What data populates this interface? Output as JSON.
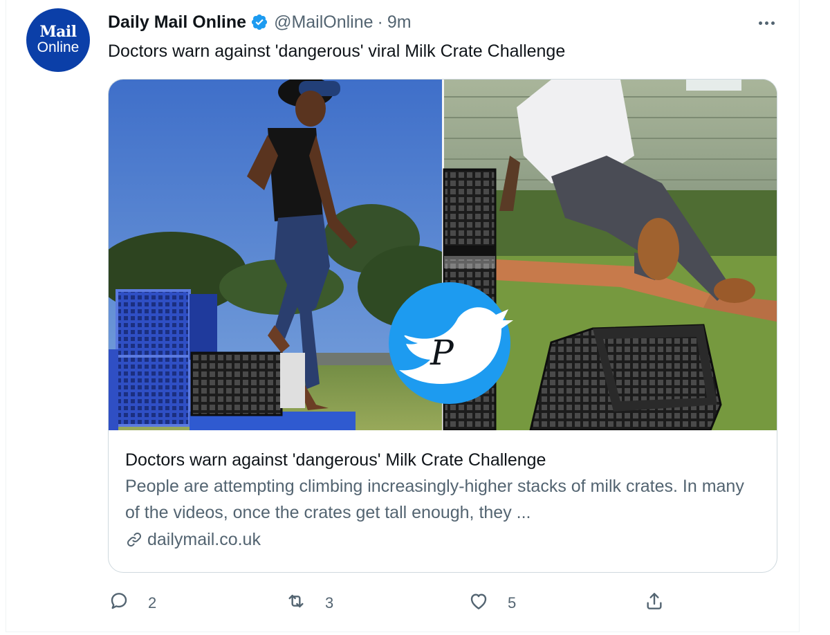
{
  "tweet": {
    "avatar": {
      "line1": "Mail",
      "line2": "Online"
    },
    "display_name": "Daily Mail Online",
    "handle": "@MailOnline",
    "separator": "·",
    "time": "9m",
    "text": "Doctors warn against 'dangerous' viral Milk Crate Challenge",
    "card": {
      "title": "Doctors warn against 'dangerous' Milk Crate Challenge",
      "description": "People are attempting climbing increasingly-higher stacks of milk crates. In many of the videos, once the crates get tall enough, they ...",
      "domain": "dailymail.co.uk",
      "watermark_letter": "P"
    },
    "actions": {
      "reply_count": "2",
      "retweet_count": "3",
      "like_count": "5"
    }
  },
  "colors": {
    "verified": "#1d9bf0",
    "avatar_bg": "#0b3fa8",
    "secondary_text": "#536471",
    "border": "#cfd9de"
  },
  "icons": [
    "verified-badge-icon",
    "more-icon",
    "link-icon",
    "reply-icon",
    "retweet-icon",
    "like-icon",
    "share-icon",
    "twitter-bird-watermark-icon"
  ]
}
